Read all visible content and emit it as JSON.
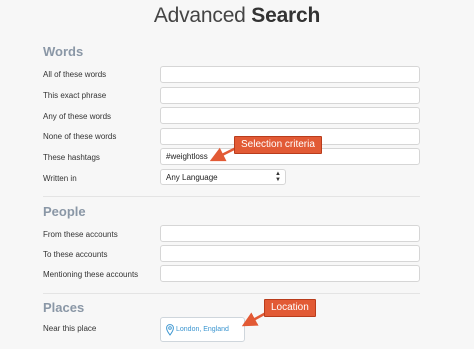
{
  "header": {
    "title_regular": "Advanced",
    "title_bold": "Search"
  },
  "words": {
    "heading": "Words",
    "all_label": "All of these words",
    "all_value": "",
    "phrase_label": "This exact phrase",
    "phrase_value": "",
    "any_label": "Any of these words",
    "any_value": "",
    "none_label": "None of these words",
    "none_value": "",
    "hashtags_label": "These hashtags",
    "hashtags_value": "#weightloss",
    "language_label": "Written in",
    "language_value": "Any Language"
  },
  "people": {
    "heading": "People",
    "from_label": "From these accounts",
    "from_value": "",
    "to_label": "To these accounts",
    "to_value": "",
    "mention_label": "Mentioning these accounts",
    "mention_value": ""
  },
  "places": {
    "heading": "Places",
    "near_label": "Near this place",
    "near_value": "London, England"
  },
  "annotations": {
    "criteria": "Selection criteria",
    "location": "Location",
    "color": "#e25a35"
  },
  "icons": {
    "place": "location-pin-icon",
    "select": "select-arrows-icon"
  }
}
